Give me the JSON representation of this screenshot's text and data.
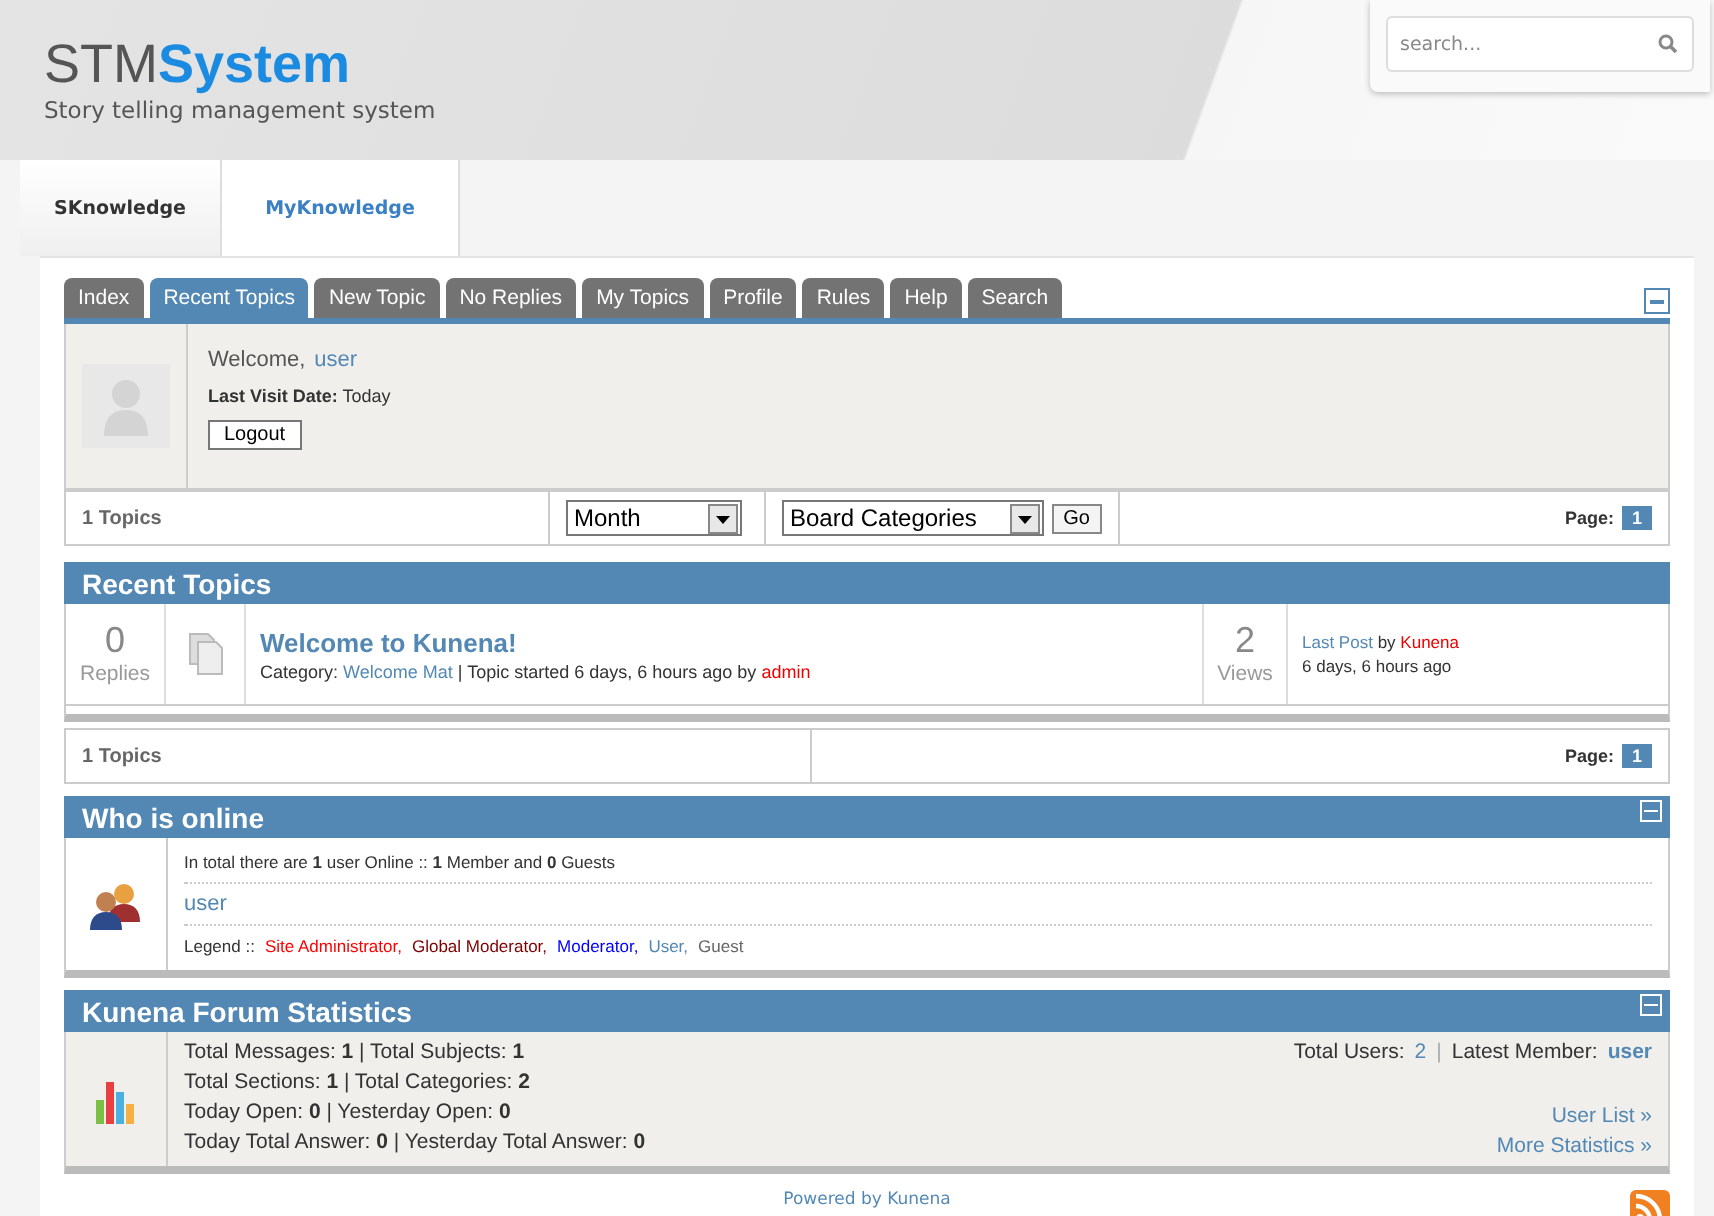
{
  "site": {
    "logo_light": "STM",
    "logo_bold": "System",
    "tagline": "Story telling management system"
  },
  "search": {
    "placeholder": "search..."
  },
  "main_tabs": [
    {
      "label": "SKnowledge",
      "selected": false
    },
    {
      "label": "MyKnowledge",
      "selected": true
    }
  ],
  "forum_tabs": [
    {
      "label": "Index",
      "selected": false
    },
    {
      "label": "Recent Topics",
      "selected": true
    },
    {
      "label": "New Topic",
      "selected": false
    },
    {
      "label": "No Replies",
      "selected": false
    },
    {
      "label": "My Topics",
      "selected": false
    },
    {
      "label": "Profile",
      "selected": false
    },
    {
      "label": "Rules",
      "selected": false
    },
    {
      "label": "Help",
      "selected": false
    },
    {
      "label": "Search",
      "selected": false
    }
  ],
  "welcome": {
    "greeting": "Welcome,",
    "user": "user",
    "last_visit": "**Last Visit Date:** Today",
    "logout": "Logout"
  },
  "filter_bar": {
    "count": "1 Topics",
    "period": "Month",
    "category": "Board Categories",
    "go": "Go",
    "page_label": "Page:",
    "page": "1"
  },
  "recent_topics": {
    "title": "Recent Topics",
    "topics": [
      {
        "replies": "0",
        "replies_label": "Replies",
        "title": "Welcome to Kunena!",
        "category_label": "Category:",
        "category": "Welcome Mat",
        "started": "| Topic started 6 days, 6 hours ago by",
        "author": "admin",
        "views": "2",
        "views_label": "Views",
        "last_post": "Last Post",
        "by": "by",
        "last_author": "Kunena",
        "last_time": "6 days, 6 hours ago"
      }
    ],
    "count": "1 Topics",
    "page_label": "Page:",
    "page": "1"
  },
  "who_is_online": {
    "title": "Who is online",
    "summary": "In total there are **1** user Online  ::  **1** Member and **0** Guests",
    "users": [
      "user"
    ],
    "legend_label": "Legend ::",
    "legend": [
      {
        "label": "Site Administrator,",
        "color": "#ff0000"
      },
      {
        "label": "Global Moderator,",
        "color": "#800000"
      },
      {
        "label": "Moderator,",
        "color": "#0000ff"
      },
      {
        "label": "User,",
        "color": "#5388b4"
      },
      {
        "label": "Guest",
        "color": "#666666"
      }
    ]
  },
  "statistics": {
    "title": "Kunena Forum Statistics",
    "lines": [
      "Total Messages: **1**  |  Total Subjects: **1**",
      "Total Sections: **1**  |  Total Categories: **2**",
      "Today Open: **0**  |  Yesterday Open: **0**",
      "Today Total Answer: **0**  |  Yesterday Total Answer: **0**"
    ],
    "total_users_label": "Total Users:",
    "total_users": "2",
    "separator": "|",
    "latest_member_label": "Latest Member:",
    "latest_member": "user",
    "links": [
      "User List »",
      "More Statistics »"
    ]
  },
  "footer": {
    "powered": "Powered by Kunena"
  }
}
